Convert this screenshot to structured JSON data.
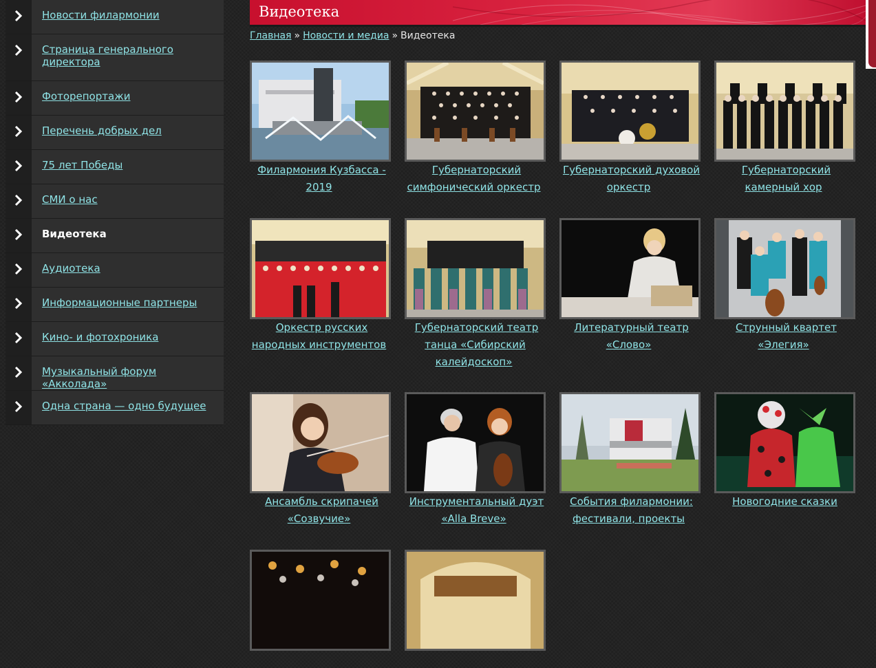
{
  "sidebar": {
    "items": [
      {
        "label": "Новости филармонии",
        "active": false
      },
      {
        "label": "Страница генерального директора",
        "active": false
      },
      {
        "label": "Фоторепортажи",
        "active": false
      },
      {
        "label": "Перечень добрых дел",
        "active": false
      },
      {
        "label": "75 лет Победы",
        "active": false
      },
      {
        "label": "СМИ о нас",
        "active": false
      },
      {
        "label": "Видеотека",
        "active": true
      },
      {
        "label": "Аудиотека",
        "active": false
      },
      {
        "label": "Информационные партнеры",
        "active": false
      },
      {
        "label": "Кино- и фотохроника",
        "active": false
      },
      {
        "label": "Музыкальный форум «Акколада»",
        "active": false
      },
      {
        "label": "Одна страна — одно будущее",
        "active": false
      }
    ]
  },
  "header": {
    "title": "Видеотека"
  },
  "breadcrumb": {
    "home": "Главная",
    "section": "Новости и медиа",
    "current": "Видеотека",
    "separator": "»"
  },
  "gallery": {
    "items": [
      {
        "title": "Филармония Кузбасса - 2019",
        "icon": "building-fountain-photo"
      },
      {
        "title": "Губернаторский симфонический оркестр",
        "icon": "orchestra-photo"
      },
      {
        "title": "Губернаторский духовой оркестр",
        "icon": "brass-band-photo"
      },
      {
        "title": "Губернаторский камерный хор",
        "icon": "choir-photo"
      },
      {
        "title": "Оркестр русских народных инструментов",
        "icon": "folk-orchestra-photo"
      },
      {
        "title": "Губернаторский театр танца «Сибирский калейдоскоп»",
        "icon": "dance-theatre-photo"
      },
      {
        "title": "Литературный театр «Слово»",
        "icon": "actress-photo"
      },
      {
        "title": "Струнный квартет «Элегия»",
        "icon": "string-quartet-photo"
      },
      {
        "title": "Ансамбль скрипачей «Созвучие»",
        "icon": "violinist-photo"
      },
      {
        "title": "Инструментальный дуэт «Alla Breve»",
        "icon": "duo-photo"
      },
      {
        "title": "События филармонии: фестивали, проекты",
        "icon": "philharmonic-building-photo"
      },
      {
        "title": "Новогодние сказки",
        "icon": "fairy-tale-photo"
      },
      {
        "title": "",
        "icon": "concert-stage-photo"
      },
      {
        "title": "",
        "icon": "concert-hall-photo"
      }
    ]
  }
}
